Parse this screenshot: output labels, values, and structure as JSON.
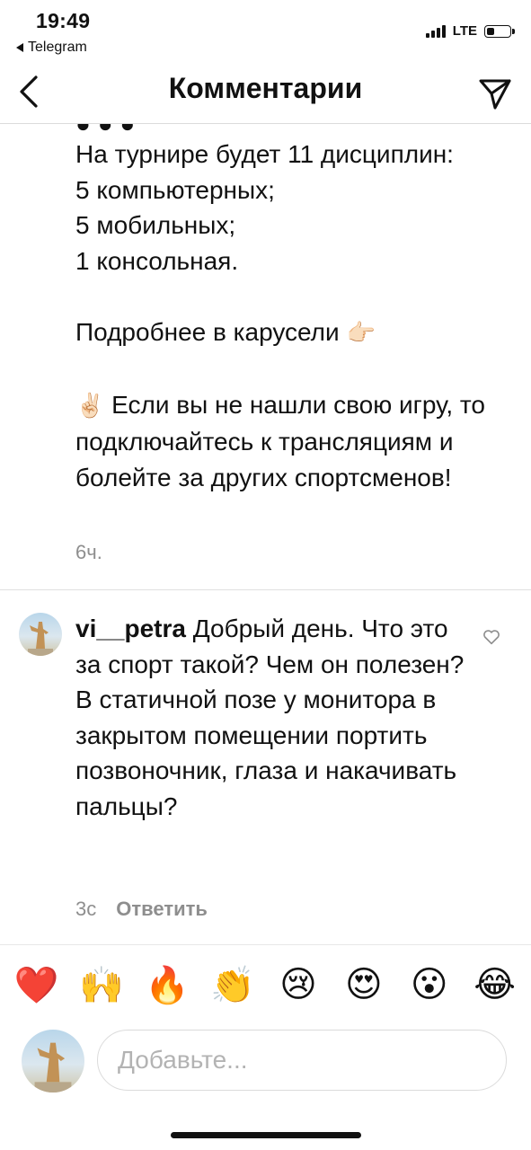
{
  "status_bar": {
    "time": "19:49",
    "back_app": "Telegram",
    "network": "LTE",
    "battery_level": 0.35
  },
  "nav": {
    "title": "Комментарии",
    "back_icon": "chevron-left-icon",
    "send_icon": "direct-send-icon"
  },
  "caption": {
    "lines_1": [
      "На турнире будет 11 дисциплин:",
      "5 компьютерных;",
      "5 мобильных;",
      "1 консольная."
    ],
    "more_text": "Подробнее в карусели",
    "more_emoji": "👉🏻",
    "victory_emoji": "✌🏻",
    "para_text": "Если вы не нашли свою игру, то подключайтесь к трансляциям и болейте за других спортсменов!",
    "time": "6ч."
  },
  "comment": {
    "username": "vi__petra",
    "text_first": "Добрый день. Что это за спорт  такой? Чем он полезен?",
    "text_second": "В статичной позе у монитора в закрытом помещении портить позвоночник, глаза и накачивать пальцы?",
    "time": "3с",
    "reply_label": "Ответить",
    "like_icon": "heart-outline-icon"
  },
  "emoji_bar": [
    {
      "name": "heart-emoji",
      "char": "❤️"
    },
    {
      "name": "raised-hands-emoji",
      "char": "🙌"
    },
    {
      "name": "fire-emoji",
      "char": "🔥"
    },
    {
      "name": "clapping-hands-emoji",
      "char": "👏"
    },
    {
      "name": "crying-face-emoji",
      "char": "😢"
    },
    {
      "name": "heart-eyes-emoji",
      "char": "😍"
    },
    {
      "name": "surprised-face-emoji",
      "char": "😮"
    },
    {
      "name": "tears-of-joy-emoji",
      "char": "😂"
    }
  ],
  "input": {
    "placeholder": "Добавьте..."
  },
  "colors": {
    "text": "#111111",
    "muted": "#8e8e8e",
    "divider": "#dbdbdb"
  }
}
